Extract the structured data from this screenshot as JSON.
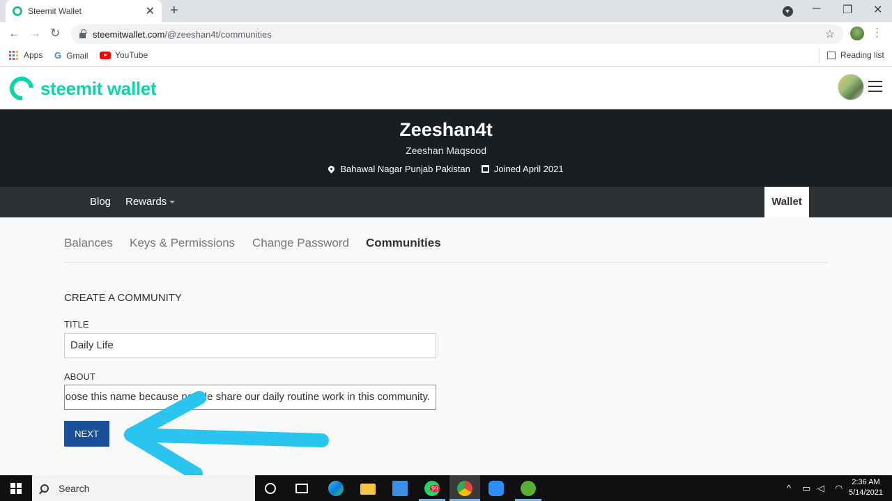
{
  "browser": {
    "tab_title": "Steemit Wallet",
    "url_host": "steemitwallet.com",
    "url_path": "/@zeeshan4t/communities",
    "bookmarks": [
      "Apps",
      "Gmail",
      "YouTube"
    ],
    "reading_list": "Reading list"
  },
  "site": {
    "logo_text": "steemit wallet",
    "brand_color": "#06d6a9"
  },
  "profile": {
    "username": "Zeeshan4t",
    "full_name": "Zeeshan Maqsood",
    "location": "Bahawal Nagar Punjab Pakistan",
    "joined": "Joined April 2021"
  },
  "profile_nav": {
    "blog": "Blog",
    "rewards": "Rewards",
    "wallet": "Wallet"
  },
  "subnav": {
    "balances": "Balances",
    "keys": "Keys & Permissions",
    "password": "Change Password",
    "communities": "Communities"
  },
  "form": {
    "section_title": "CREATE A COMMUNITY",
    "title_label": "TITLE",
    "title_value": "Daily Life",
    "about_label": "ABOUT",
    "about_value": "I choose this name because people share our daily routine work in this community.",
    "next_label": "NEXT"
  },
  "taskbar": {
    "search": "Search",
    "whatsapp_badge": "99",
    "time": "2:36 AM",
    "date": "5/14/2021"
  }
}
